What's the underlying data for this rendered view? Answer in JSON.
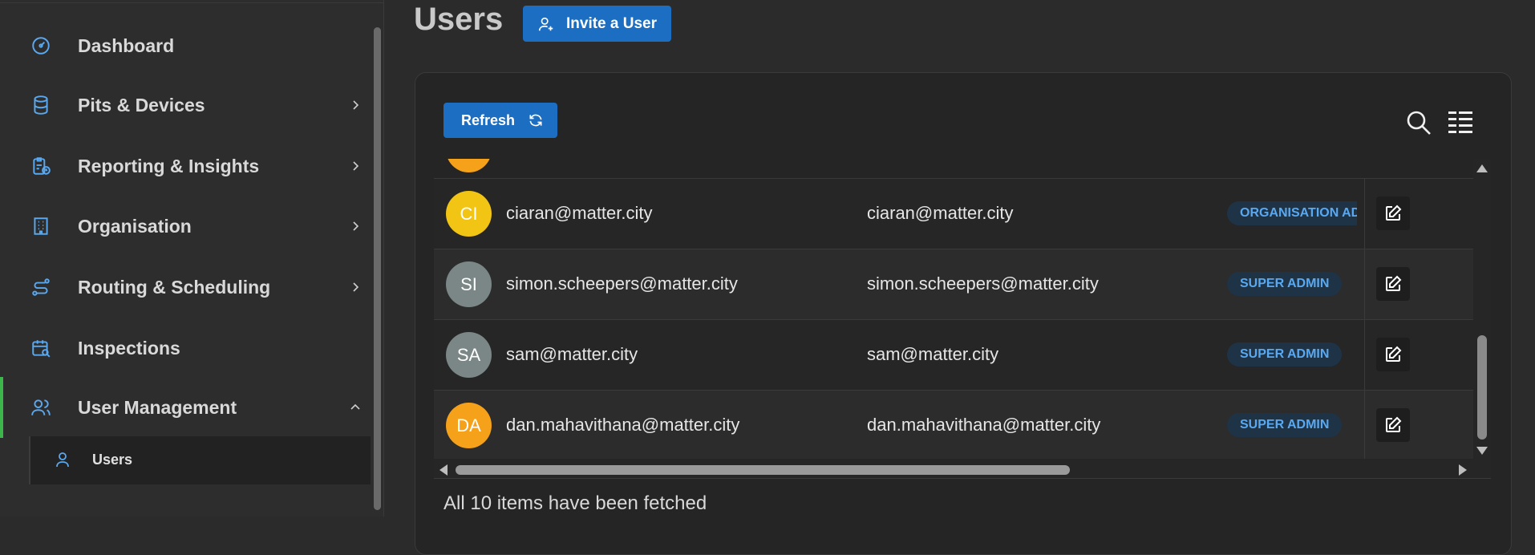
{
  "sidebar": {
    "items": [
      {
        "label": "Dashboard",
        "icon": "gauge-icon",
        "expandable": false
      },
      {
        "label": "Pits & Devices",
        "icon": "database-icon",
        "expandable": true
      },
      {
        "label": "Reporting & Insights",
        "icon": "clipboard-report-icon",
        "expandable": true
      },
      {
        "label": "Organisation",
        "icon": "building-icon",
        "expandable": true
      },
      {
        "label": "Routing & Scheduling",
        "icon": "route-icon",
        "expandable": true
      },
      {
        "label": "Inspections",
        "icon": "calendar-search-icon",
        "expandable": false
      },
      {
        "label": "User Management",
        "icon": "users-icon",
        "expandable": true,
        "expanded": true
      }
    ],
    "sub_items": [
      {
        "label": "Users",
        "icon": "user-icon"
      }
    ]
  },
  "header": {
    "title": "Users",
    "invite_label": "Invite a User"
  },
  "toolbar": {
    "refresh_label": "Refresh"
  },
  "table": {
    "rows": [
      {
        "initials": "CI",
        "avatar_color": "#f2c414",
        "name": "ciaran@matter.city",
        "email": "ciaran@matter.city",
        "role": "ORGANISATION ADMIN"
      },
      {
        "initials": "SI",
        "avatar_color": "#7a8786",
        "name": "simon.scheepers@matter.city",
        "email": "simon.scheepers@matter.city",
        "role": "SUPER ADMIN"
      },
      {
        "initials": "SA",
        "avatar_color": "#7a8786",
        "name": "sam@matter.city",
        "email": "sam@matter.city",
        "role": "SUPER ADMIN"
      },
      {
        "initials": "DA",
        "avatar_color": "#f5a11a",
        "name": "dan.mahavithana@matter.city",
        "email": "dan.mahavithana@matter.city",
        "role": "SUPER ADMIN"
      }
    ]
  },
  "status": "All 10 items have been fetched",
  "colors": {
    "primary": "#1b6ec2",
    "active_accent": "#3cb54a",
    "badge_text": "#5aa9f0"
  }
}
